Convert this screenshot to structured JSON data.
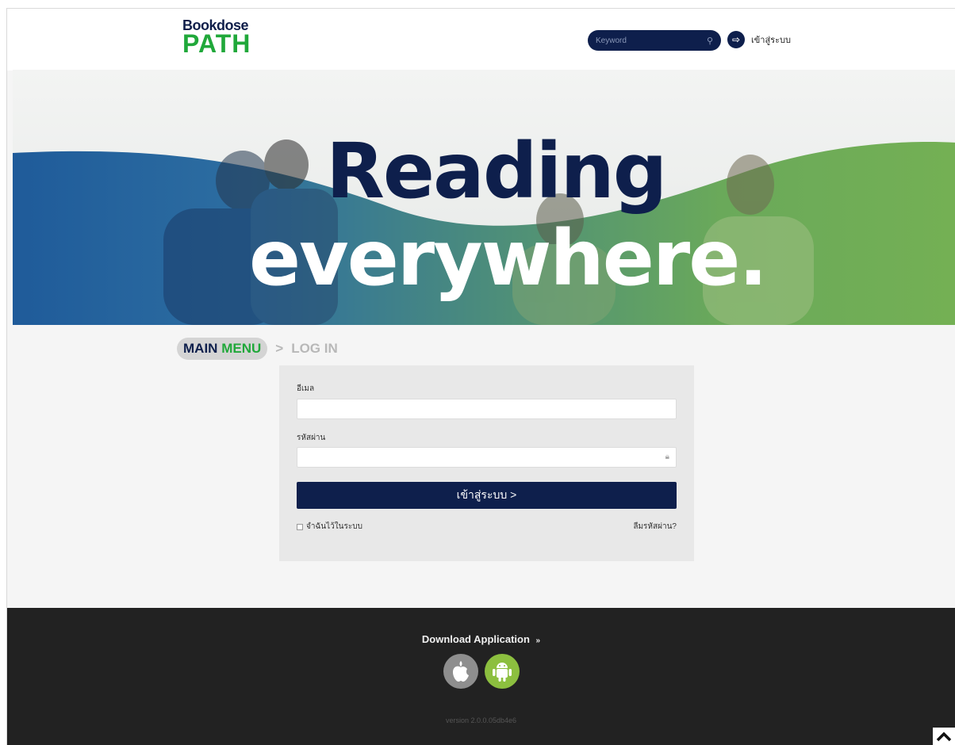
{
  "header": {
    "logo_top": "Bookdose",
    "logo_main": "PATH",
    "search_placeholder": "Keyword",
    "login_label": "เข้าสู่ระบบ"
  },
  "hero": {
    "line1": "Reading",
    "line2": "everywhere."
  },
  "breadcrumb": {
    "main_part1": "MAIN",
    "main_part2": "MENU",
    "separator": ">",
    "current": "LOG IN"
  },
  "login_form": {
    "email_label": "อีเมล",
    "email_value": "",
    "password_label": "รหัสผ่าน",
    "password_value": "",
    "submit_label": "เข้าสู่ระบบ >",
    "remember_label": "จำฉันไว้ในระบบ",
    "forgot_label": "ลืมรหัสผ่าน?"
  },
  "footer": {
    "download_title": "Download Application",
    "download_chevron": "»",
    "apps": [
      "apple-icon",
      "android-icon"
    ],
    "version": "version 2.0.0.05db4e6"
  },
  "colors": {
    "navy": "#0e1f4c",
    "green": "#20a83a",
    "footer_bg": "#222222"
  }
}
